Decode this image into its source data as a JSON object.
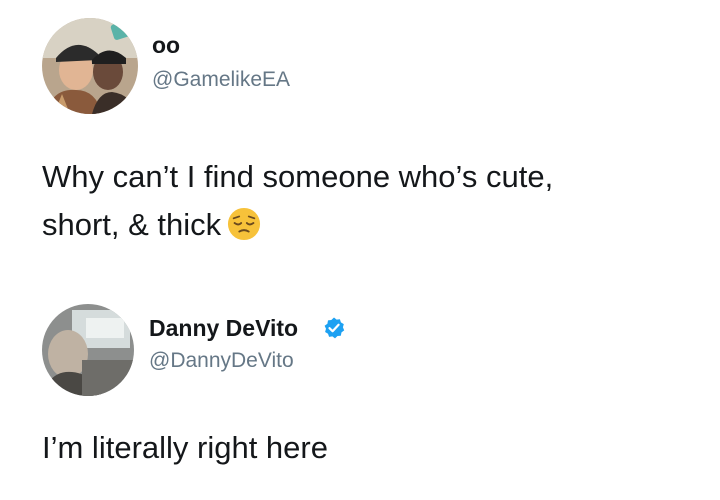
{
  "tweets": [
    {
      "display_name": "oo",
      "handle": "@GamelikeEA",
      "verified": false,
      "text_lines": [
        "Why can’t I find someone who’s cute,",
        "short, & thick"
      ],
      "trailing_emoji": "pensive-face-icon"
    },
    {
      "display_name": "Danny DeVito",
      "handle": "@DannyDeVito",
      "verified": true,
      "text_lines": [
        "I’m literally right here"
      ]
    }
  ],
  "colors": {
    "text": "#14171a",
    "handle": "#657786",
    "verified_blue": "#1da1f2",
    "emoji_yellow": "#f7c23a"
  }
}
